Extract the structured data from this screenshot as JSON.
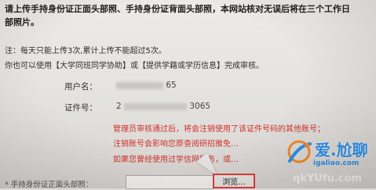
{
  "heading": {
    "line1": "请上传手持身份证正面头部照、手持身份证背面头部照，本网站核对无误后将在三个工作日",
    "line2": "部照片。"
  },
  "notes": {
    "limit": "注：每天只能上传3次,累计上传不能超过5次。",
    "alternative": "你也可以使用【大学同班同学协助】或【提供学籍或学历信息】完成审核。"
  },
  "form": {
    "username_label": "用户名：",
    "username_value_suffix": "65",
    "cert_label": "证件号：",
    "cert_value_prefix": "2",
    "cert_value_suffix": "3065"
  },
  "warnings": {
    "line1": "管理员审核通过后，将会注销使用了该证件号码的其他账号；",
    "line2": "注销账号会影响您原查阅研招推免…",
    "line3": "如果您曾经使用过学信网服务，或…"
  },
  "upload": {
    "label": "* 手持身份证正面头部照：",
    "browse_label": "浏览..."
  },
  "watermark": {
    "brand": "爱.尬聊",
    "url": "igaliao.com",
    "url_faint": "qkYUfu.com"
  },
  "colors": {
    "warning_red": "#d0312d",
    "highlight_border": "#e23b3b",
    "watermark_blue": "#2f8fe8"
  }
}
